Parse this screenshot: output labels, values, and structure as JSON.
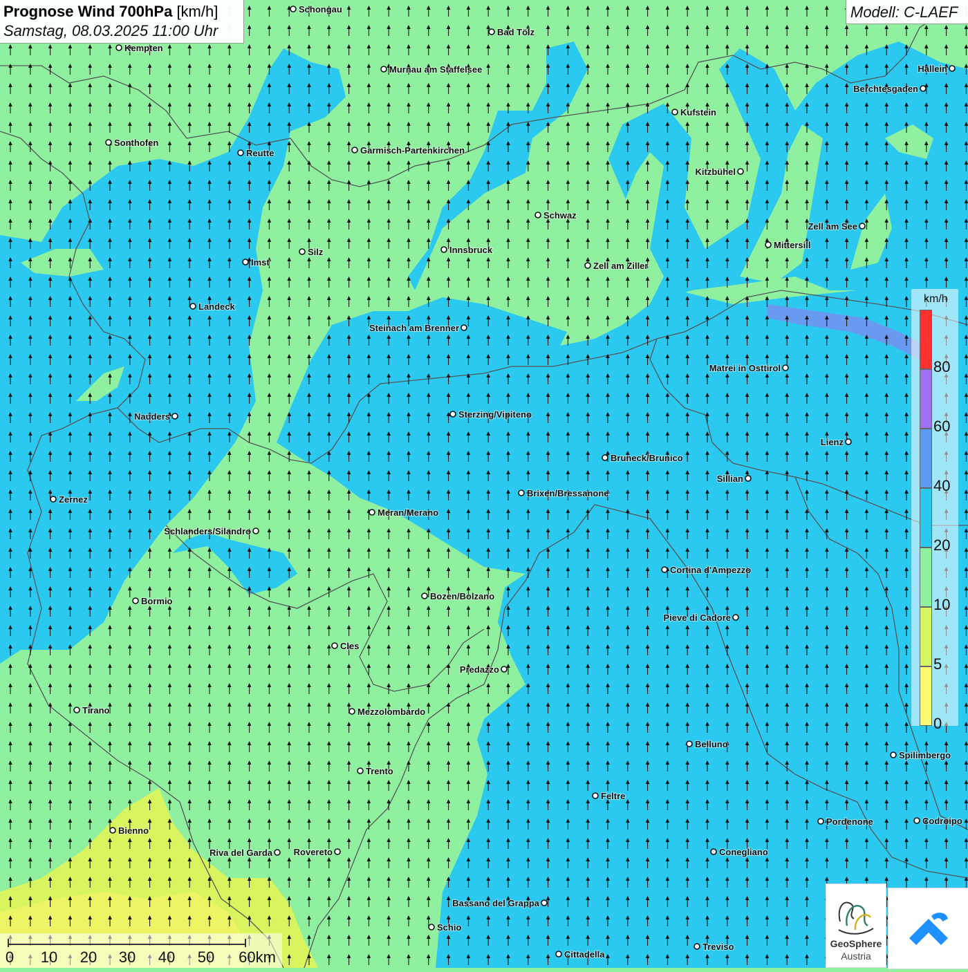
{
  "header": {
    "title_bold": "Prognose Wind 700hPa",
    "title_unit": "[km/h]",
    "datetime": "Samstag, 08.03.2025 11:00 Uhr",
    "model": "Modell: C-LAEF"
  },
  "legend": {
    "unit": "km/h",
    "ticks": [
      "80",
      "60",
      "40",
      "20",
      "10",
      "5",
      "0"
    ],
    "colors": [
      "#ff3030",
      "#a070f0",
      "#5a9bf0",
      "#2bc8f0",
      "#8ff0a0",
      "#d8f560",
      "#fafa70"
    ]
  },
  "scale_bar": {
    "labels": [
      "0",
      "10",
      "20",
      "30",
      "40",
      "50",
      "60km"
    ]
  },
  "logos": {
    "geosphere_line1": "GeoSphere",
    "geosphere_line2": "Austria"
  },
  "cities": [
    {
      "name": "Schongau"
    },
    {
      "name": "Bad Tölz"
    },
    {
      "name": "Kempten"
    },
    {
      "name": "Murnau am Staffelsee"
    },
    {
      "name": "Hallein"
    },
    {
      "name": "Berchtesgaden"
    },
    {
      "name": "Kufstein"
    },
    {
      "name": "Sonthofen"
    },
    {
      "name": "Reutte"
    },
    {
      "name": "Garmisch-Partenkirchen"
    },
    {
      "name": "Kitzbühel"
    },
    {
      "name": "Schwaz"
    },
    {
      "name": "Zell am See"
    },
    {
      "name": "Innsbruck"
    },
    {
      "name": "Mittersill"
    },
    {
      "name": "Silz"
    },
    {
      "name": "Imst"
    },
    {
      "name": "Zell am Ziller"
    },
    {
      "name": "Landeck"
    },
    {
      "name": "Steinach am Brenner"
    },
    {
      "name": "Matrei in Osttirol"
    },
    {
      "name": "Nauders"
    },
    {
      "name": "Sterzing/Vipiteno"
    },
    {
      "name": "Lienz"
    },
    {
      "name": "Bruneck/Brunico"
    },
    {
      "name": "Sillian"
    },
    {
      "name": "Zernez"
    },
    {
      "name": "Brixen/Bressanone"
    },
    {
      "name": "Meran/Merano"
    },
    {
      "name": "Schlanders/Silandro"
    },
    {
      "name": "Cortina d'Ampezzo"
    },
    {
      "name": "Bormio"
    },
    {
      "name": "Bozen/Bolzano"
    },
    {
      "name": "Pieve di Cadore"
    },
    {
      "name": "Cles"
    },
    {
      "name": "Predazzo"
    },
    {
      "name": "Tirano"
    },
    {
      "name": "Mezzolombardo"
    },
    {
      "name": "Belluno"
    },
    {
      "name": "Spilimbergo"
    },
    {
      "name": "Trento"
    },
    {
      "name": "Feltre"
    },
    {
      "name": "Bienno"
    },
    {
      "name": "Pordenone"
    },
    {
      "name": "Codroipo"
    },
    {
      "name": "Riva del Garda"
    },
    {
      "name": "Rovereto"
    },
    {
      "name": "Conegliano"
    },
    {
      "name": "Bassano del Grappa"
    },
    {
      "name": "Schio"
    },
    {
      "name": "Treviso"
    },
    {
      "name": "Cittadella"
    }
  ]
}
